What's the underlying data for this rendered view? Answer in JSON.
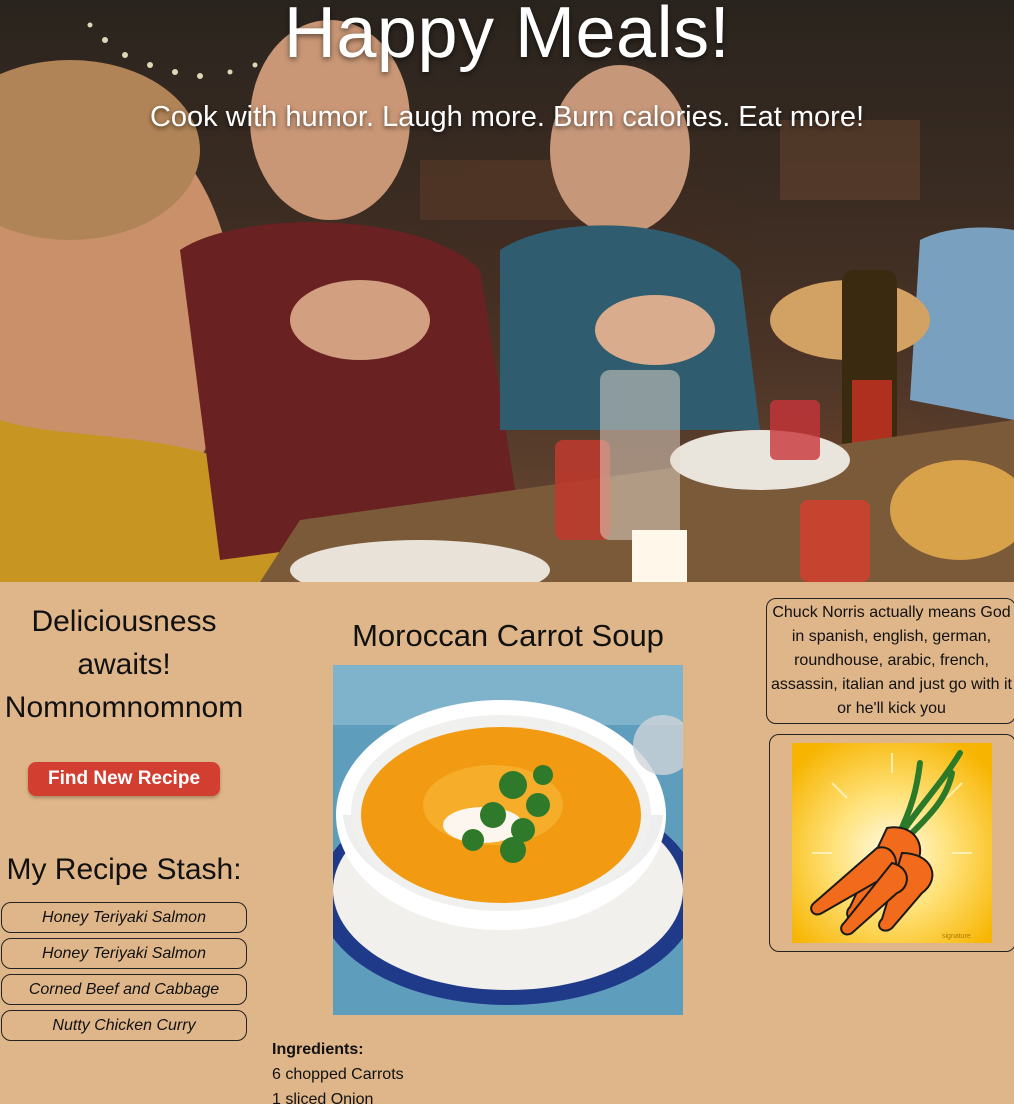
{
  "hero": {
    "title": "Happy Meals!",
    "subtitle": "Cook with humor. Laugh more. Burn calories. Eat more!"
  },
  "sidebar": {
    "tagline_line1": "Deliciousness",
    "tagline_line2": "awaits!",
    "tagline_line3": "Nomnomnomnom",
    "find_button": "Find New Recipe",
    "stash_title": "My Recipe Stash:",
    "stash_items": [
      "Honey Teriyaki Salmon",
      "Honey Teriyaki Salmon",
      "Corned Beef and Cabbage",
      "Nutty Chicken Curry"
    ]
  },
  "recipe": {
    "title": "Moroccan Carrot Soup",
    "ingredients_label": "Ingredients:",
    "ingredients": [
      "6 chopped Carrots",
      "1 sliced Onion"
    ]
  },
  "joke": {
    "text": "Chuck Norris actually means God in spanish, english, german, roundhouse, arabic, french, assassin, italian and just go with it or he'll kick you"
  },
  "colors": {
    "page_background": "#dfb689",
    "button": "#d23f31"
  }
}
